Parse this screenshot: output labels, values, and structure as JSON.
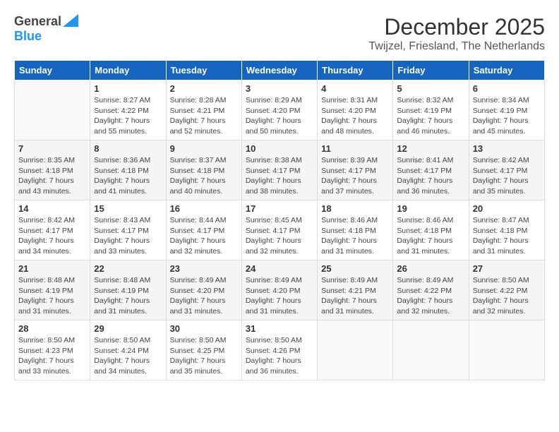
{
  "header": {
    "logo_line1": "General",
    "logo_line2": "Blue",
    "month_title": "December 2025",
    "location": "Twijzel, Friesland, The Netherlands"
  },
  "days_of_week": [
    "Sunday",
    "Monday",
    "Tuesday",
    "Wednesday",
    "Thursday",
    "Friday",
    "Saturday"
  ],
  "weeks": [
    [
      {
        "day": "",
        "info": ""
      },
      {
        "day": "1",
        "info": "Sunrise: 8:27 AM\nSunset: 4:22 PM\nDaylight: 7 hours\nand 55 minutes."
      },
      {
        "day": "2",
        "info": "Sunrise: 8:28 AM\nSunset: 4:21 PM\nDaylight: 7 hours\nand 52 minutes."
      },
      {
        "day": "3",
        "info": "Sunrise: 8:29 AM\nSunset: 4:20 PM\nDaylight: 7 hours\nand 50 minutes."
      },
      {
        "day": "4",
        "info": "Sunrise: 8:31 AM\nSunset: 4:20 PM\nDaylight: 7 hours\nand 48 minutes."
      },
      {
        "day": "5",
        "info": "Sunrise: 8:32 AM\nSunset: 4:19 PM\nDaylight: 7 hours\nand 46 minutes."
      },
      {
        "day": "6",
        "info": "Sunrise: 8:34 AM\nSunset: 4:19 PM\nDaylight: 7 hours\nand 45 minutes."
      }
    ],
    [
      {
        "day": "7",
        "info": "Sunrise: 8:35 AM\nSunset: 4:18 PM\nDaylight: 7 hours\nand 43 minutes."
      },
      {
        "day": "8",
        "info": "Sunrise: 8:36 AM\nSunset: 4:18 PM\nDaylight: 7 hours\nand 41 minutes."
      },
      {
        "day": "9",
        "info": "Sunrise: 8:37 AM\nSunset: 4:18 PM\nDaylight: 7 hours\nand 40 minutes."
      },
      {
        "day": "10",
        "info": "Sunrise: 8:38 AM\nSunset: 4:17 PM\nDaylight: 7 hours\nand 38 minutes."
      },
      {
        "day": "11",
        "info": "Sunrise: 8:39 AM\nSunset: 4:17 PM\nDaylight: 7 hours\nand 37 minutes."
      },
      {
        "day": "12",
        "info": "Sunrise: 8:41 AM\nSunset: 4:17 PM\nDaylight: 7 hours\nand 36 minutes."
      },
      {
        "day": "13",
        "info": "Sunrise: 8:42 AM\nSunset: 4:17 PM\nDaylight: 7 hours\nand 35 minutes."
      }
    ],
    [
      {
        "day": "14",
        "info": "Sunrise: 8:42 AM\nSunset: 4:17 PM\nDaylight: 7 hours\nand 34 minutes."
      },
      {
        "day": "15",
        "info": "Sunrise: 8:43 AM\nSunset: 4:17 PM\nDaylight: 7 hours\nand 33 minutes."
      },
      {
        "day": "16",
        "info": "Sunrise: 8:44 AM\nSunset: 4:17 PM\nDaylight: 7 hours\nand 32 minutes."
      },
      {
        "day": "17",
        "info": "Sunrise: 8:45 AM\nSunset: 4:17 PM\nDaylight: 7 hours\nand 32 minutes."
      },
      {
        "day": "18",
        "info": "Sunrise: 8:46 AM\nSunset: 4:18 PM\nDaylight: 7 hours\nand 31 minutes."
      },
      {
        "day": "19",
        "info": "Sunrise: 8:46 AM\nSunset: 4:18 PM\nDaylight: 7 hours\nand 31 minutes."
      },
      {
        "day": "20",
        "info": "Sunrise: 8:47 AM\nSunset: 4:18 PM\nDaylight: 7 hours\nand 31 minutes."
      }
    ],
    [
      {
        "day": "21",
        "info": "Sunrise: 8:48 AM\nSunset: 4:19 PM\nDaylight: 7 hours\nand 31 minutes."
      },
      {
        "day": "22",
        "info": "Sunrise: 8:48 AM\nSunset: 4:19 PM\nDaylight: 7 hours\nand 31 minutes."
      },
      {
        "day": "23",
        "info": "Sunrise: 8:49 AM\nSunset: 4:20 PM\nDaylight: 7 hours\nand 31 minutes."
      },
      {
        "day": "24",
        "info": "Sunrise: 8:49 AM\nSunset: 4:20 PM\nDaylight: 7 hours\nand 31 minutes."
      },
      {
        "day": "25",
        "info": "Sunrise: 8:49 AM\nSunset: 4:21 PM\nDaylight: 7 hours\nand 31 minutes."
      },
      {
        "day": "26",
        "info": "Sunrise: 8:49 AM\nSunset: 4:22 PM\nDaylight: 7 hours\nand 32 minutes."
      },
      {
        "day": "27",
        "info": "Sunrise: 8:50 AM\nSunset: 4:22 PM\nDaylight: 7 hours\nand 32 minutes."
      }
    ],
    [
      {
        "day": "28",
        "info": "Sunrise: 8:50 AM\nSunset: 4:23 PM\nDaylight: 7 hours\nand 33 minutes."
      },
      {
        "day": "29",
        "info": "Sunrise: 8:50 AM\nSunset: 4:24 PM\nDaylight: 7 hours\nand 34 minutes."
      },
      {
        "day": "30",
        "info": "Sunrise: 8:50 AM\nSunset: 4:25 PM\nDaylight: 7 hours\nand 35 minutes."
      },
      {
        "day": "31",
        "info": "Sunrise: 8:50 AM\nSunset: 4:26 PM\nDaylight: 7 hours\nand 36 minutes."
      },
      {
        "day": "",
        "info": ""
      },
      {
        "day": "",
        "info": ""
      },
      {
        "day": "",
        "info": ""
      }
    ]
  ]
}
